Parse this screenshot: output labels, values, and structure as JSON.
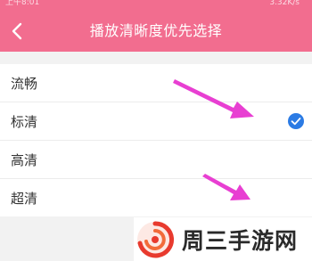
{
  "status_bar": {
    "time": "上午8:01",
    "speed": "3.32K/s"
  },
  "header": {
    "title": "播放清晰度优先选择",
    "back_icon": "chevron-left-icon",
    "bg_color": "#f26d8f"
  },
  "options": [
    {
      "label": "流畅",
      "selected": false
    },
    {
      "label": "标清",
      "selected": true
    },
    {
      "label": "高清",
      "selected": false
    },
    {
      "label": "超清",
      "selected": false
    }
  ],
  "check_icon": "check-circle-icon",
  "accent_color": "#2b7be4",
  "annotation_arrow_color": "#e83fd2",
  "watermark": {
    "text": "周三手游网",
    "logo_icon": "swirl-logo-icon"
  }
}
